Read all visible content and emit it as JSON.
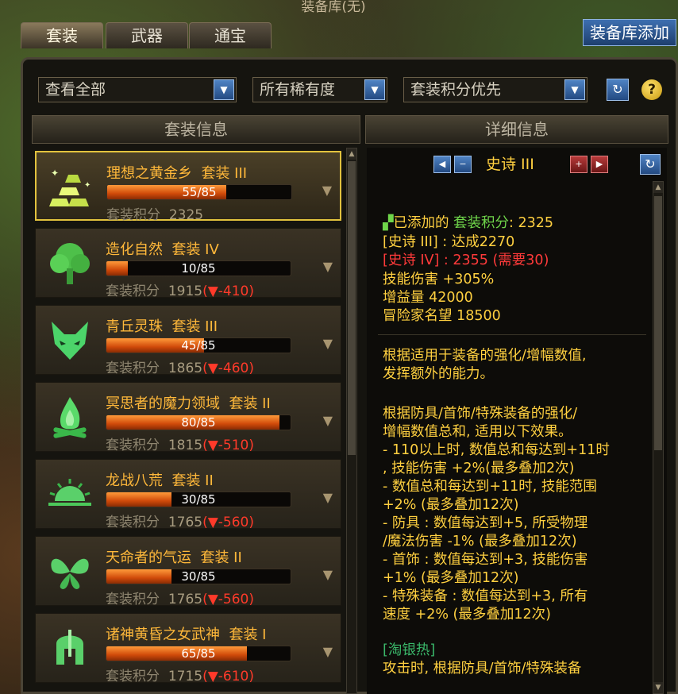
{
  "window": {
    "title": "装备库(无)"
  },
  "tabs": [
    {
      "label": "套装",
      "active": true
    },
    {
      "label": "武器",
      "active": false
    },
    {
      "label": "通宝",
      "active": false
    }
  ],
  "add_button": "装备库添加",
  "filters": {
    "view": "查看全部",
    "rarity": "所有稀有度",
    "sort": "套装积分优先"
  },
  "left_header": "套装信息",
  "right_header": "详细信息",
  "sets": [
    {
      "name": "理想之黄金乡",
      "tag": "套装 III",
      "progress": "55/85",
      "fraction": 0.647,
      "score_label": "套装积分",
      "score": "2325",
      "delta": "",
      "icon": "gold-bars-icon",
      "selected": true
    },
    {
      "name": "造化自然",
      "tag": "套装 IV",
      "progress": "10/85",
      "fraction": 0.118,
      "score_label": "套装积分",
      "score": "1915",
      "delta": "(▼-410)",
      "icon": "tree-icon",
      "selected": false
    },
    {
      "name": "青丘灵珠",
      "tag": "套装 III",
      "progress": "45/85",
      "fraction": 0.529,
      "score_label": "套装积分",
      "score": "1865",
      "delta": "(▼-460)",
      "icon": "fox-icon",
      "selected": false
    },
    {
      "name": "冥思者的魔力领域",
      "tag": "套装 II",
      "progress": "80/85",
      "fraction": 0.941,
      "score_label": "套装积分",
      "score": "1815",
      "delta": "(▼-510)",
      "icon": "bonfire-icon",
      "selected": false
    },
    {
      "name": "龙战八荒",
      "tag": "套装 II",
      "progress": "30/85",
      "fraction": 0.353,
      "score_label": "套装积分",
      "score": "1765",
      "delta": "(▼-560)",
      "icon": "rising-sun-icon",
      "selected": false
    },
    {
      "name": "天命者的气运",
      "tag": "套装 II",
      "progress": "30/85",
      "fraction": 0.353,
      "score_label": "套装积分",
      "score": "1765",
      "delta": "(▼-560)",
      "icon": "butterfly-icon",
      "selected": false
    },
    {
      "name": "诸神黄昏之女武神",
      "tag": "套装 I",
      "progress": "65/85",
      "fraction": 0.765,
      "score_label": "套装积分",
      "score": "1715",
      "delta": "(▼-610)",
      "icon": "helmet-icon",
      "selected": false
    }
  ],
  "detail": {
    "tier": "史诗 III",
    "added_label": "已添加的",
    "score_label": "套装积分",
    "score_value": ": 2325",
    "achieved": "[史诗 III] : 达成2270",
    "next": "[史诗 IV] : 2355 (需要30)",
    "stats": [
      "技能伤害 +305%",
      "增益量 42000",
      "冒险家名望 18500"
    ],
    "desc1": [
      "根据适用于装备的强化/增幅数值,",
      "发挥额外的能力。"
    ],
    "desc2": [
      "根据防具/首饰/特殊装备的强化/",
      "增幅数值总和, 适用以下效果。",
      "- 110以上时, 数值总和每达到+11时",
      ", 技能伤害 +2%(最多叠加2次)",
      "- 数值总和每达到+11时, 技能范围",
      "+2% (最多叠加12次)",
      "- 防具 : 数值每达到+5, 所受物理",
      "/魔法伤害 -1% (最多叠加12次)",
      "- 首饰 : 数值每达到+3, 技能伤害",
      "+1% (最多叠加12次)",
      "- 特殊装备 : 数值每达到+3, 所有",
      "速度 +2% (最多叠加12次)"
    ],
    "sub_title": "[淘银热]",
    "sub_line": "攻击时, 根据防具/首饰/特殊装备"
  }
}
